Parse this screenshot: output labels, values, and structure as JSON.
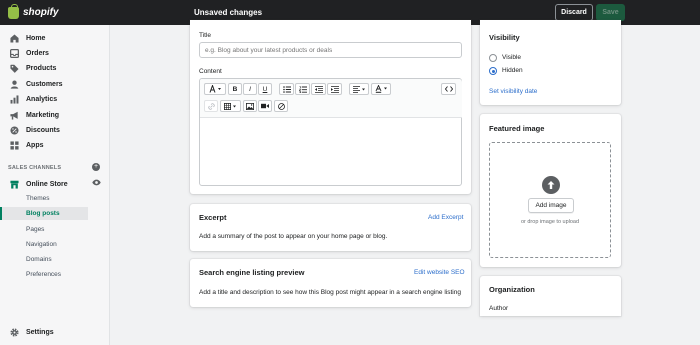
{
  "brand": {
    "name": "shopify"
  },
  "topbar": {
    "title": "Unsaved changes",
    "discard_label": "Discard",
    "save_label": "Save"
  },
  "sidebar": {
    "items": [
      {
        "label": "Home",
        "icon": "home-icon"
      },
      {
        "label": "Orders",
        "icon": "orders-icon"
      },
      {
        "label": "Products",
        "icon": "tag-icon"
      },
      {
        "label": "Customers",
        "icon": "person-icon"
      },
      {
        "label": "Analytics",
        "icon": "bar-chart-icon"
      },
      {
        "label": "Marketing",
        "icon": "megaphone-icon"
      },
      {
        "label": "Discounts",
        "icon": "discount-icon"
      },
      {
        "label": "Apps",
        "icon": "apps-icon"
      }
    ],
    "sales_channels_label": "SALES CHANNELS",
    "online_store_label": "Online Store",
    "online_store_sub": [
      {
        "label": "Themes"
      },
      {
        "label": "Blog posts"
      },
      {
        "label": "Pages"
      },
      {
        "label": "Navigation"
      },
      {
        "label": "Domains"
      },
      {
        "label": "Preferences"
      }
    ],
    "settings_label": "Settings"
  },
  "post_form": {
    "title_label": "Title",
    "title_placeholder": "e.g. Blog about your latest products or deals",
    "content_label": "Content"
  },
  "excerpt": {
    "title": "Excerpt",
    "action": "Add Excerpt",
    "text": "Add a summary of the post to appear on your home page or blog."
  },
  "seo": {
    "title": "Search engine listing preview",
    "action": "Edit website SEO",
    "text": "Add a title and description to see how this Blog post might appear in a search engine listing"
  },
  "visibility": {
    "title": "Visibility",
    "options": [
      "Visible",
      "Hidden"
    ],
    "selected": "Hidden",
    "set_date_link": "Set visibility date"
  },
  "featured_image": {
    "title": "Featured image",
    "add_button": "Add image",
    "hint": "or drop image to upload"
  },
  "organization": {
    "title": "Organization",
    "author_label": "Author"
  },
  "colors": {
    "accent": "#008060",
    "link": "#2c6ecb",
    "topbar": "#202123"
  }
}
